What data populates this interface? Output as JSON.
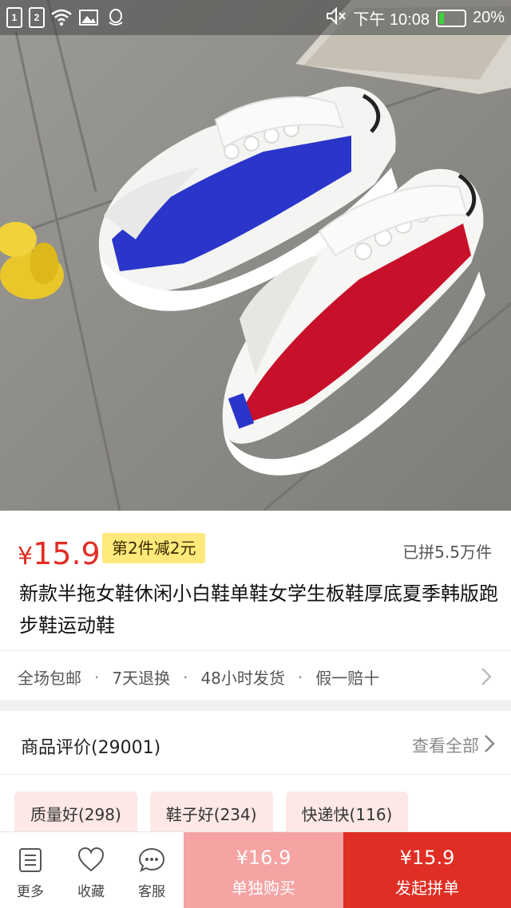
{
  "status_bar": {
    "sim1": "1",
    "sim2": "2",
    "time": "下午 10:08",
    "battery": "20%",
    "battery_level": 0.2
  },
  "product": {
    "price_currency": "¥",
    "price": "15.9",
    "promo": "第2件减2元",
    "sold": "已拼5.5万件",
    "title": "新款半拖女鞋休闲小白鞋单鞋女学生板鞋厚底夏季韩版跑步鞋运动鞋"
  },
  "services": [
    "全场包邮",
    "7天退换",
    "48小时发货",
    "假一赔十"
  ],
  "reviews": {
    "title": "商品评价(29001)",
    "view_all": "查看全部",
    "tags": [
      "质量好(298)",
      "鞋子好(234)",
      "快递快(116)"
    ]
  },
  "bottom_bar": {
    "more": "更多",
    "favorite": "收藏",
    "service": "客服",
    "solo_price": "¥16.9",
    "solo_label": "单独购买",
    "group_price": "¥15.9",
    "group_label": "发起拼单"
  },
  "colors": {
    "accent": "#e02e24",
    "solo_button": "#f5a3a3",
    "promo_bg": "#ffe97a",
    "tag_bg": "#fde8e6"
  }
}
